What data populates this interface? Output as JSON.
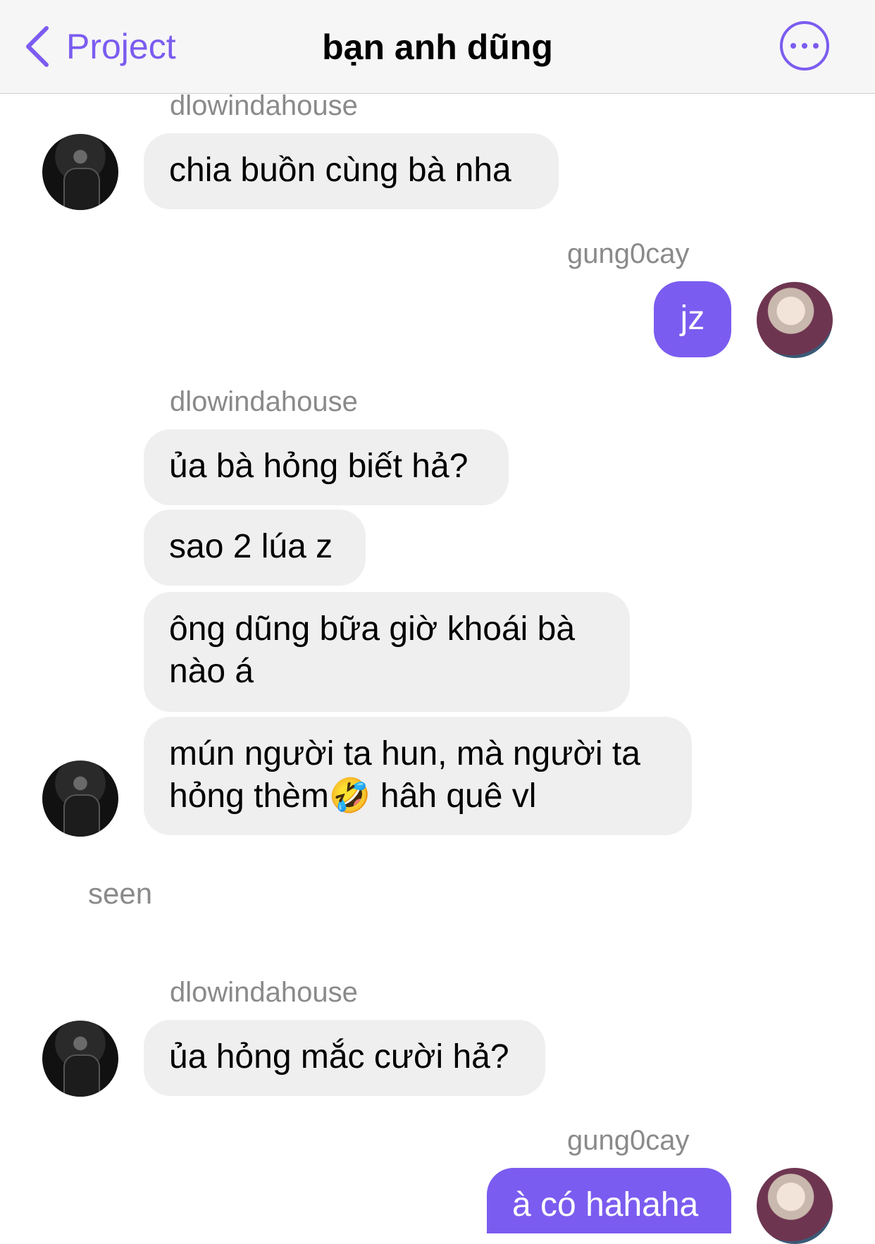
{
  "header": {
    "back_label": "Project",
    "title": "bạn anh dũng",
    "accent_color": "#7b5cf0"
  },
  "messages": {
    "m1": {
      "sender": "dlowindahouse",
      "text": "chia buồn cùng bà nha"
    },
    "m2": {
      "sender": "gung0cay",
      "text": "jz"
    },
    "m3": {
      "sender": "dlowindahouse",
      "text": "ủa bà hỏng biết hả?"
    },
    "m4": {
      "text": "sao 2 lúa z"
    },
    "m5": {
      "text": "ông dũng bữa giờ khoái bà\nnào á"
    },
    "m6": {
      "text": "mún người ta hun, mà người ta\nhỏng thèm🤣 hâh quê vl"
    },
    "seen": "seen",
    "m7": {
      "sender": "dlowindahouse",
      "text": "ủa hỏng mắc cười hả?"
    },
    "m8": {
      "sender": "gung0cay",
      "text": "à có hahaha"
    }
  }
}
